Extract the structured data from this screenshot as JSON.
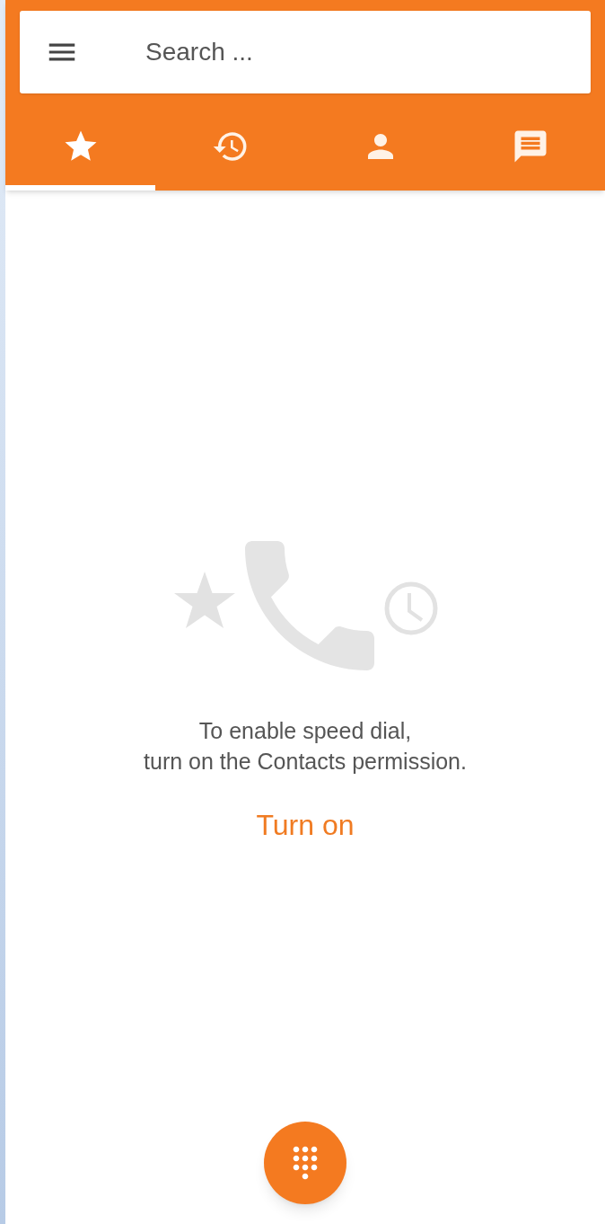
{
  "search": {
    "placeholder": "Search ..."
  },
  "tabs": [
    {
      "kind": "favorites",
      "selected": true
    },
    {
      "kind": "recents",
      "selected": false
    },
    {
      "kind": "contacts",
      "selected": false
    },
    {
      "kind": "messages",
      "selected": false
    }
  ],
  "empty_state": {
    "message": [
      "To enable speed dial,",
      "turn on the Contacts permission."
    ],
    "action": "Turn on"
  }
}
